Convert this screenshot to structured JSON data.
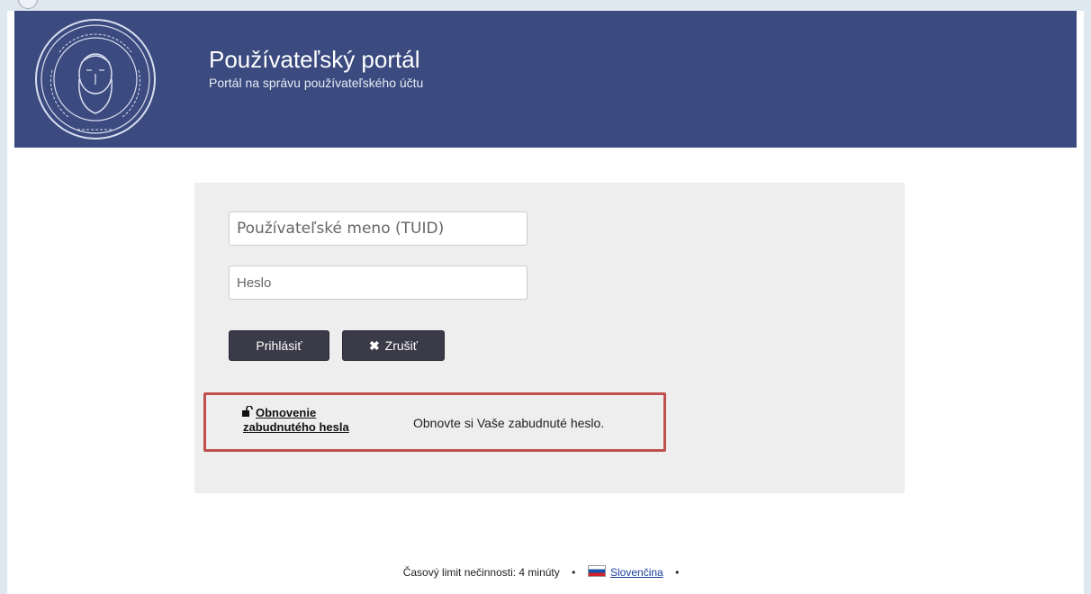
{
  "header": {
    "title": "Používateľský portál",
    "subtitle": "Portál na správu používateľského účtu",
    "brand_color": "#3b4a7f"
  },
  "login_form": {
    "username_placeholder": "Používateľské meno (TUID)",
    "password_placeholder": "Heslo",
    "login_label": "Prihlásiť",
    "cancel_label": "Zrušiť",
    "cancel_icon": "close-icon",
    "button_color": "#3a3a48"
  },
  "password_reset": {
    "link_label": "Obnovenie zabudnutého hesla",
    "description": "Obnovte si Vaše zabudnuté heslo.",
    "icon": "unlock-icon",
    "highlight_color": "#c0504d"
  },
  "footer": {
    "timeout_text": "Časový limit nečinnosti: 4 minúty",
    "language_label": "Slovenčina",
    "flag_icon": "slovak-flag-icon"
  }
}
